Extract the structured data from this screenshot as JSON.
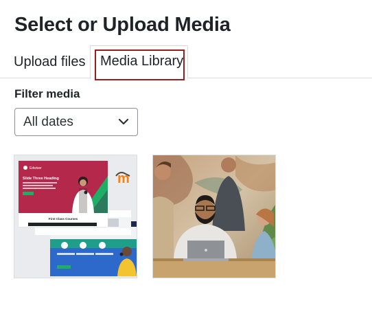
{
  "modal": {
    "title": "Select or Upload Media"
  },
  "tabs": [
    {
      "label": "Upload files",
      "active": false
    },
    {
      "label": "Media Library",
      "active": true
    }
  ],
  "filter": {
    "label": "Filter media",
    "selected": "All dates"
  },
  "media": {
    "items": [
      {
        "kind": "website-screenshot",
        "hero_heading": "Slide Three Heading",
        "brand": "Edwiser",
        "section_heading": "First Class Courses"
      },
      {
        "kind": "team-photo"
      }
    ]
  },
  "colors": {
    "focus_ring": "#9c1c1c",
    "hero_bg": "#b4284c",
    "accent_green": "#1fae66",
    "accent_blue": "#2f5fd6"
  }
}
